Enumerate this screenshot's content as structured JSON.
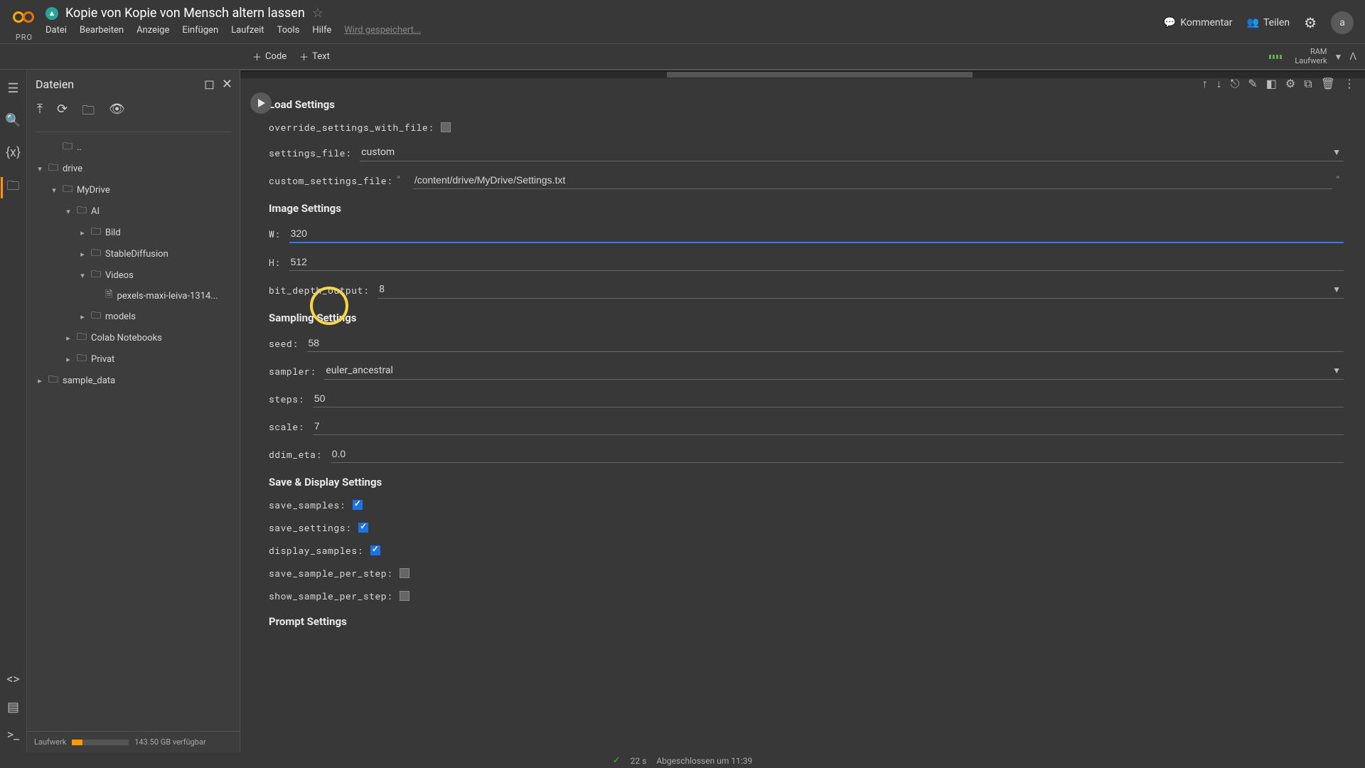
{
  "header": {
    "pro_label": "PRO",
    "notebook_title": "Kopie von Kopie von Mensch altern lassen",
    "menu": [
      "Datei",
      "Bearbeiten",
      "Anzeige",
      "Einfügen",
      "Laufzeit",
      "Tools",
      "Hilfe"
    ],
    "saving_status": "Wird gespeichert...",
    "comment_label": "Kommentar",
    "share_label": "Teilen",
    "avatar_letter": "a"
  },
  "toolbar": {
    "code_label": "Code",
    "text_label": "Text",
    "ram_label": "RAM",
    "disk_label": "Laufwerk"
  },
  "sidebar": {
    "title": "Dateien",
    "tree": {
      "dots": "..",
      "drive": "drive",
      "mydrive": "MyDrive",
      "ai": "AI",
      "bild": "Bild",
      "sd": "StableDiffusion",
      "videos": "Videos",
      "videofile": "pexels-maxi-leiva-1314...",
      "models": "models",
      "colab": "Colab Notebooks",
      "privat": "Privat",
      "sample": "sample_data"
    },
    "footer": {
      "label": "Laufwerk",
      "text": "143.50 GB verfügbar"
    }
  },
  "form": {
    "s1": "Load Settings",
    "override_label": "override_settings_with_file:",
    "settings_file_label": "settings_file:",
    "settings_file_value": "custom",
    "custom_file_label": "custom_settings_file:",
    "custom_file_value": "/content/drive/MyDrive/Settings.txt",
    "s2": "Image Settings",
    "w_label": "W:",
    "w_value": "320",
    "h_label": "H:",
    "h_value": "512",
    "bit_label": "bit_depth_output:",
    "bit_value": "8",
    "s3": "Sampling Settings",
    "seed_label": "seed:",
    "seed_value": "58",
    "sampler_label": "sampler:",
    "sampler_value": "euler_ancestral",
    "steps_label": "steps:",
    "steps_value": "50",
    "scale_label": "scale:",
    "scale_value": "7",
    "ddim_label": "ddim_eta:",
    "ddim_value": "0.0",
    "s4": "Save & Display Settings",
    "save_samples_label": "save_samples:",
    "save_settings_label": "save_settings:",
    "display_samples_label": "display_samples:",
    "save_per_step_label": "save_sample_per_step:",
    "show_per_step_label": "show_sample_per_step:",
    "s5": "Prompt Settings"
  },
  "status": {
    "time": "22 s",
    "text": "Abgeschlossen um 11:39"
  }
}
